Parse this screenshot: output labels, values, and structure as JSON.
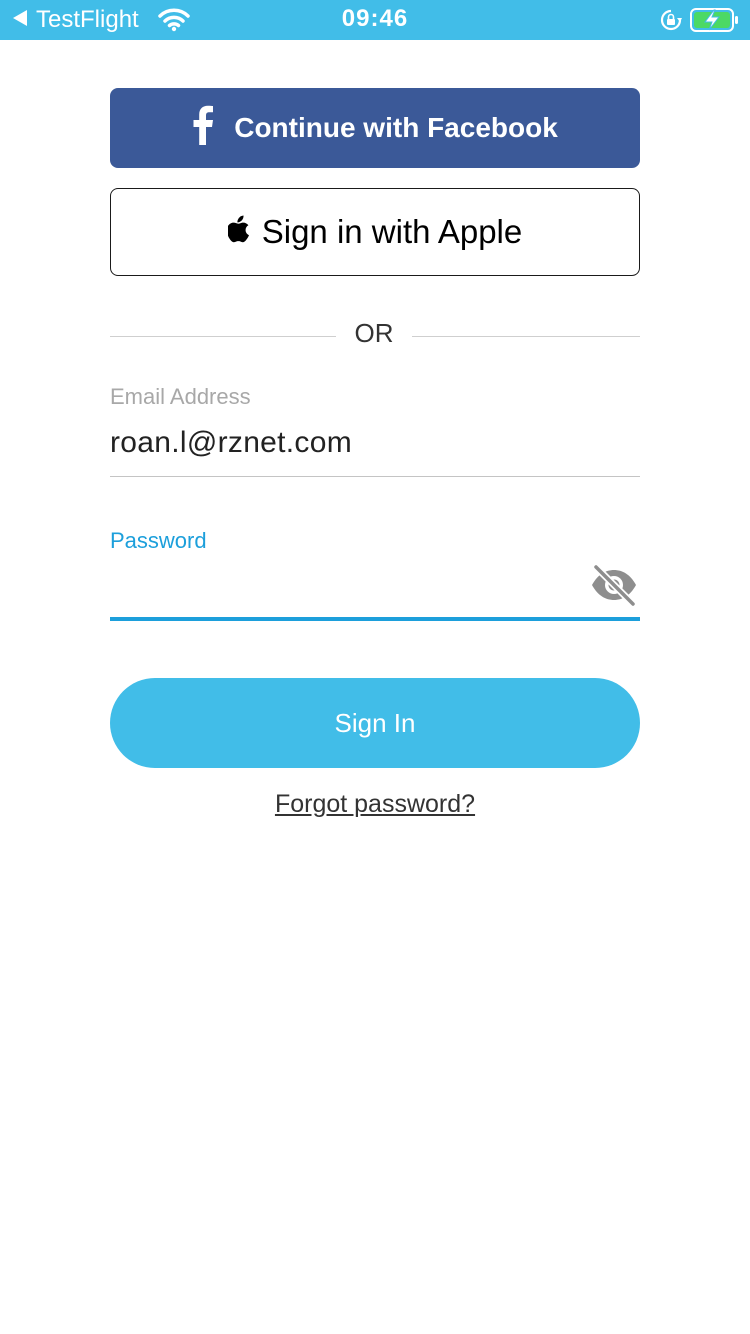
{
  "status_bar": {
    "back_label": "TestFlight",
    "time": "09:46",
    "icons": [
      "back-arrow-icon",
      "wifi-icon",
      "orientation-lock-icon",
      "battery-charging-icon"
    ]
  },
  "social": {
    "facebook_label": "Continue with Facebook",
    "apple_label": "Sign in with Apple"
  },
  "divider": {
    "label": "OR"
  },
  "email": {
    "label": "Email Address",
    "value": "roan.l@rznet.com"
  },
  "password": {
    "label": "Password",
    "value": "",
    "toggle_icon": "eye-slash-icon"
  },
  "sign_in_label": "Sign In",
  "forgot_label": "Forgot password?",
  "colors": {
    "status_bar": "#41bde8",
    "facebook": "#3b5998",
    "accent": "#1c9fdb",
    "sign_in": "#41bde8"
  }
}
